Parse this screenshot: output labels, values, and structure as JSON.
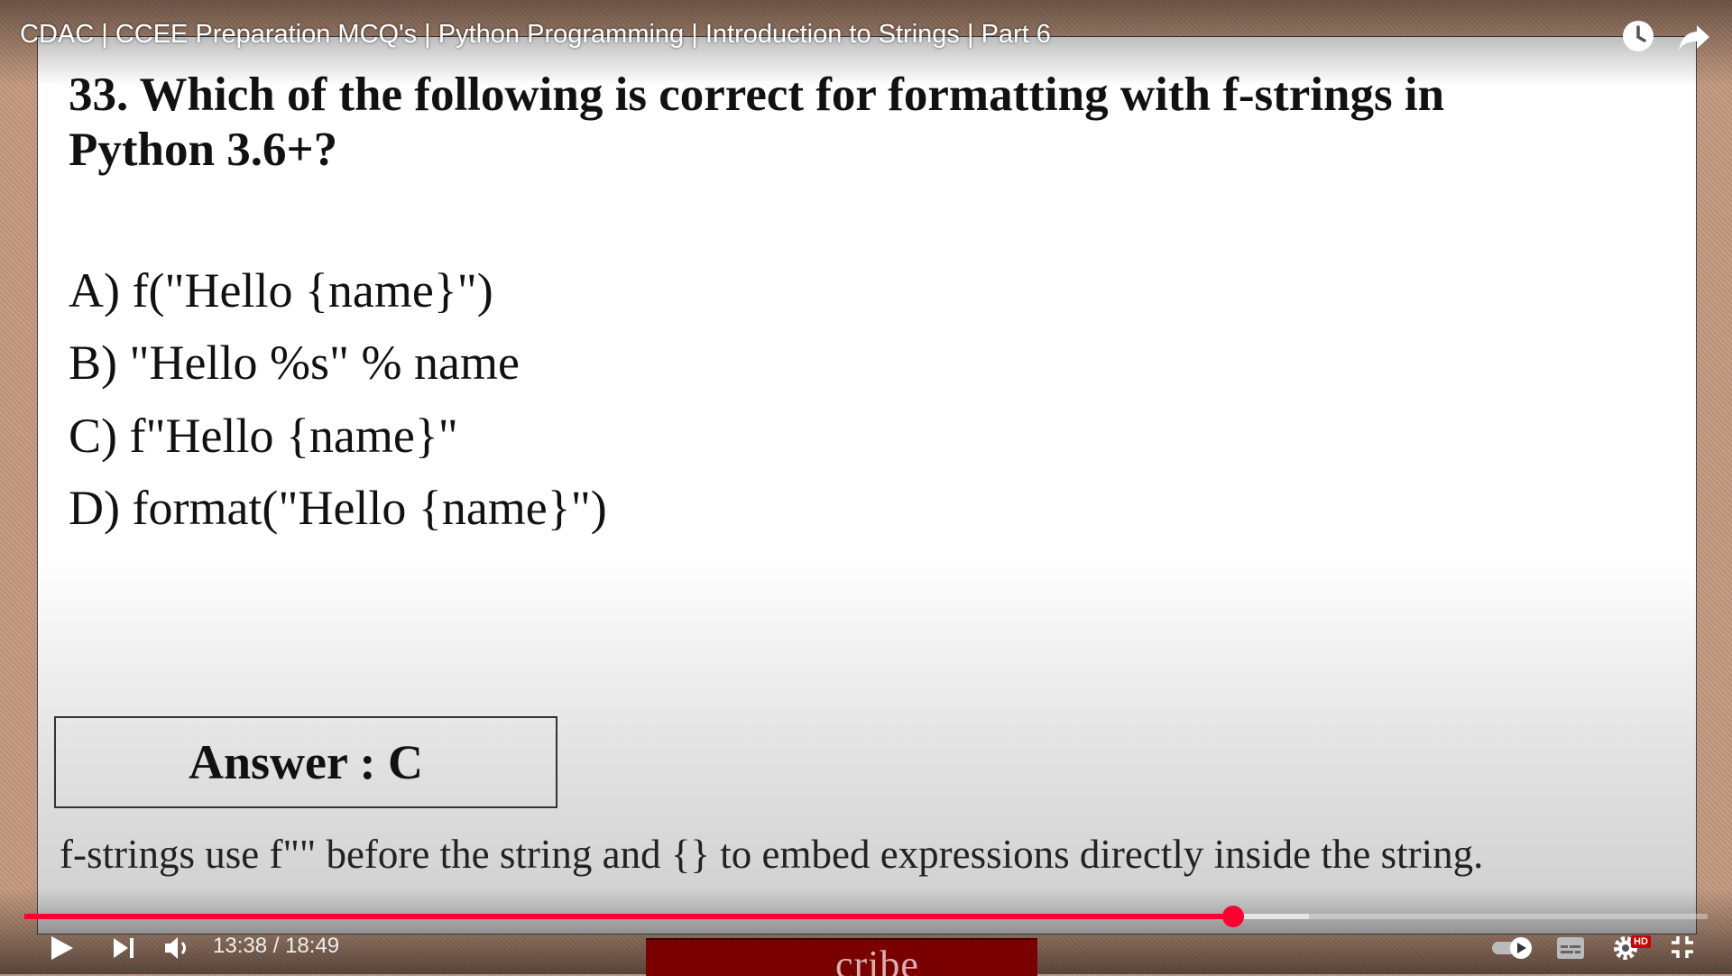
{
  "video": {
    "title": "CDAC | CCEE Preparation MCQ's | Python Programming | Introduction to Strings | Part 6",
    "time_display": "13:38 / 18:49",
    "progress_played_fraction": 0.718,
    "progress_buffered_fraction": 0.763,
    "quality_badge": "HD",
    "subscribe_partial": "cribe",
    "accent_color": "#ff0033"
  },
  "slide": {
    "question": "33. Which of the following is correct for formatting with f-strings in Python 3.6+?",
    "options": [
      "A) f(\"Hello {name}\")",
      "B) \"Hello %s\" % name",
      "C) f\"Hello {name}\"",
      "D) format(\"Hello {name}\")"
    ],
    "answer": "Answer : C",
    "explanation": "f-strings use f\"\" before the string and {} to embed expressions directly inside the string."
  },
  "icons": {
    "watch_later": "clock-icon",
    "share": "share-arrow-icon",
    "play": "play-icon",
    "next": "next-icon",
    "volume": "volume-icon",
    "autoplay": "autoplay-toggle-icon",
    "captions": "captions-icon",
    "settings": "gear-icon",
    "exit_fullscreen": "exit-fullscreen-icon"
  }
}
